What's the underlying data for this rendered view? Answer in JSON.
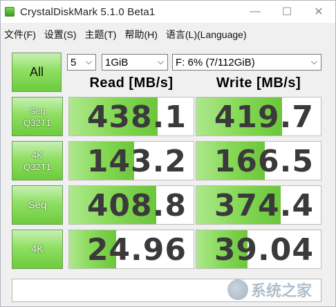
{
  "window": {
    "title": "CrystalDiskMark 5.1.0 Beta1",
    "buttons": {
      "minimize": "—",
      "maximize": "☐",
      "close": "✕"
    }
  },
  "menu": [
    "文件(F)",
    "设置(S)",
    "主题(T)",
    "帮助(H)",
    "语言(L)(Language)"
  ],
  "controls": {
    "all_label": "All",
    "count": "5",
    "size": "1GiB",
    "drive": "F: 6% (7/112GiB)"
  },
  "headers": {
    "read": "Read [MB/s]",
    "write": "Write [MB/s]"
  },
  "rows": [
    {
      "label_line1": "Seq",
      "label_line2": "Q32T1",
      "read": "438.1",
      "write": "419.7",
      "read_fill": 0.71,
      "write_fill": 0.69
    },
    {
      "label_line1": "4K",
      "label_line2": "Q32T1",
      "read": "143.2",
      "write": "166.5",
      "read_fill": 0.52,
      "write_fill": 0.55
    },
    {
      "label_line1": "Seq",
      "label_line2": "",
      "read": "408.8",
      "write": "374.4",
      "read_fill": 0.7,
      "write_fill": 0.68
    },
    {
      "label_line1": "4K",
      "label_line2": "",
      "read": "24.96",
      "write": "39.04",
      "read_fill": 0.38,
      "write_fill": 0.41
    }
  ],
  "status_text": "",
  "watermark": {
    "text": "系统之家",
    "icon": "house-logo-icon"
  },
  "colors": {
    "green_button": "#8fdf62",
    "bar_green": "#86d957",
    "value_text": "#3a3a3a"
  }
}
